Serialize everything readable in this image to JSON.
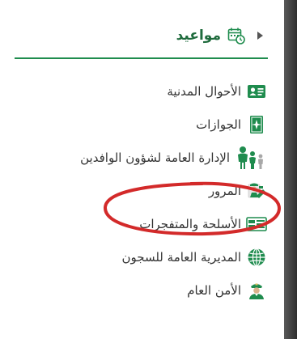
{
  "header": {
    "title": "مواعيد",
    "icon": "calendar-clock-icon",
    "toggle_icon": "chevron-right-icon"
  },
  "menu": {
    "items": [
      {
        "label": "الأحوال المدنية",
        "icon": "id-card-icon"
      },
      {
        "label": "الجوازات",
        "icon": "passport-icon"
      },
      {
        "label": "الإدارة العامة لشؤون الوافدين",
        "icon": "family-icon"
      },
      {
        "label": "المرور",
        "icon": "traffic-officer-icon"
      },
      {
        "label": "الأسلحة والمتفجرات",
        "icon": "weapons-icon"
      },
      {
        "label": "المديرية العامة للسجون",
        "icon": "globe-icon"
      },
      {
        "label": "الأمن العام",
        "icon": "security-officer-icon"
      }
    ]
  },
  "colors": {
    "accent": "#1f8c4e",
    "title": "#1f6b3d",
    "text": "#333333",
    "highlight_ellipse": "#d32a2a"
  }
}
